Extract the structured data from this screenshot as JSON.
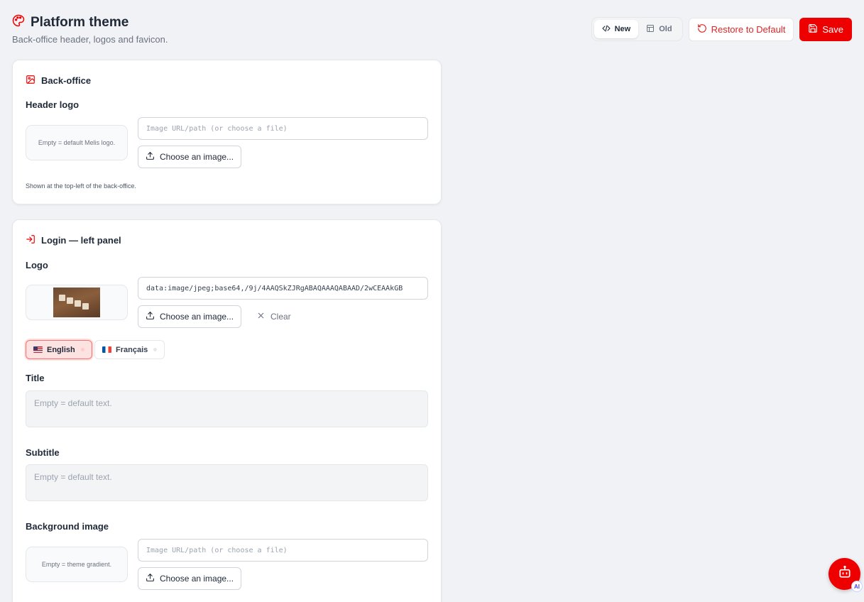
{
  "header": {
    "title": "Platform theme",
    "subtitle": "Back-office header, logos and favicon."
  },
  "actions": {
    "toggle_new": "New",
    "toggle_old": "Old",
    "active_toggle": "New",
    "restore_label": "Restore to Default",
    "save_label": "Save"
  },
  "backoffice": {
    "title": "Back-office",
    "header_logo": {
      "label": "Header logo",
      "preview_text": "Empty = default Melis logo.",
      "placeholder": "Image URL/path (or choose a file)",
      "choose_label": "Choose an image...",
      "hint": "Shown at the top-left of the back-office."
    }
  },
  "login": {
    "title": "Login — left panel",
    "logo": {
      "label": "Logo",
      "value": "data:image/jpeg;base64,/9j/4AAQSkZJRgABAQAAAQABAAD/2wCEAAkGB",
      "choose_label": "Choose an image...",
      "clear_label": "Clear"
    },
    "languages": [
      {
        "label": "English",
        "active": true
      },
      {
        "label": "Français",
        "active": false
      }
    ],
    "title_field": {
      "label": "Title",
      "placeholder": "Empty = default text."
    },
    "subtitle_field": {
      "label": "Subtitle",
      "placeholder": "Empty = default text."
    },
    "background": {
      "label": "Background image",
      "preview_text": "Empty = theme gradient.",
      "placeholder": "Image URL/path (or choose a file)",
      "choose_label": "Choose an image..."
    }
  },
  "assistant": {
    "badge": "AI"
  },
  "colors": {
    "accent": "#ef0000",
    "background": "#f1f2f5"
  }
}
